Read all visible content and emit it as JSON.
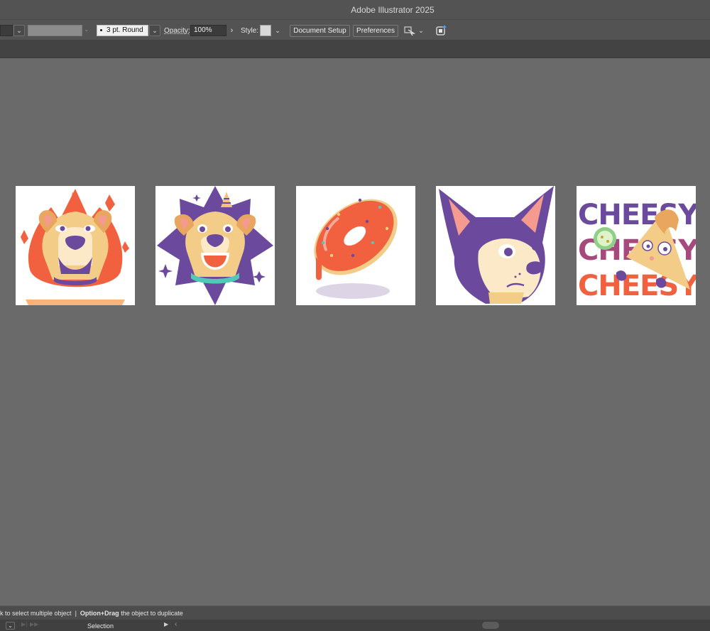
{
  "app": {
    "title": "Adobe Illustrator 2025"
  },
  "controlbar": {
    "brush_label": "3 pt. Round",
    "opacity_label": "Opacity:",
    "opacity_value": "100%",
    "style_label": "Style:",
    "document_setup": "Document Setup",
    "preferences": "Preferences",
    "chevron": "⌄",
    "arrow_right": "›"
  },
  "artboards": [
    {
      "name": "fire-dog"
    },
    {
      "name": "party-dog"
    },
    {
      "name": "donut"
    },
    {
      "name": "chihuahua"
    },
    {
      "name": "cheesy-nachos",
      "text": "CHEESY"
    }
  ],
  "status": {
    "hint_part1": "k to select multiple object",
    "hint_sep": "|",
    "hint_bold": "Option+Drag",
    "hint_part2": "the object to duplicate",
    "tool": "Selection",
    "play_icon": "▶",
    "prev_icon": "‹"
  },
  "colors": {
    "canvas": "#6a6a6a",
    "panel": "#535353",
    "orange": "#f1603f",
    "purple": "#6b4a9e",
    "tan": "#f3cc88",
    "cream": "#fbe9c8"
  }
}
